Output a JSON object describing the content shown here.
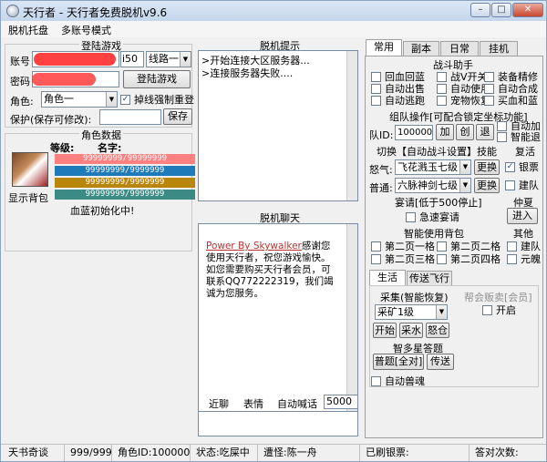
{
  "window": {
    "title": "天行者 - 天行者免费脱机v9.6",
    "controls": {
      "minimize": "–",
      "maximize": "□",
      "close": "✕"
    }
  },
  "menu": [
    "脱机托盘",
    "多账号模式"
  ],
  "login": {
    "title": "登陆游戏",
    "account_label": "账号",
    "account_value": "",
    "server_value": "i50",
    "line_value": "线路一",
    "password_label": "密码",
    "password_value": "",
    "login_button": "登陆游戏",
    "role_label": "角色:",
    "role_value": "角色一",
    "reconnect_label": "掉线强制重登",
    "reconnect_checked": true,
    "protect_label": "保护(保存可修改):",
    "protect_value": "",
    "save_button": "保存"
  },
  "role_data": {
    "title": "角色数据",
    "level_label": "等级:",
    "name_label": "名字:",
    "bars": [
      {
        "text": "99999999/99999999",
        "color": "#ff8080",
        "text_color": "#ffffff"
      },
      {
        "text": "99999999/9999999",
        "color": "#1e7ab8",
        "text_color": "#ffffff"
      },
      {
        "text": "99999999/9999999",
        "color": "#b8860b",
        "text_color": "#ffffff"
      },
      {
        "text": "99999999/9999999",
        "color": "#3c8a84",
        "text_color": "#ffffff"
      }
    ],
    "show_bag": "显示背包",
    "status": "血蓝初始化中!"
  },
  "offline_tips": {
    "title": "脱机提示",
    "lines": [
      ">开始连接大区服务器...",
      ">连接服务器失败...."
    ]
  },
  "offline_chat": {
    "title": "脱机聊天",
    "power_line": "Power By Skywalker",
    "message": "感谢您使用天行者，祝您游戏愉快。如您需要购买天行者会员，可联系QQ772222319，我们竭诚为您服务。",
    "tabs": [
      "近聊",
      "表情",
      "自动喊话"
    ],
    "shout_interval": "5000",
    "input_value": ""
  },
  "right_tabs": [
    "常用",
    "副本",
    "日常",
    "挂机"
  ],
  "battle_helper": {
    "title": "战斗助手",
    "checks": [
      {
        "label": "回血回蓝",
        "checked": false
      },
      {
        "label": "战V开关",
        "checked": false
      },
      {
        "label": "装备精修",
        "checked": false
      },
      {
        "label": "自动出售",
        "checked": false
      },
      {
        "label": "自动使用",
        "checked": false
      },
      {
        "label": "自动合成",
        "checked": false
      },
      {
        "label": "自动逃跑",
        "checked": false
      },
      {
        "label": "宠物恢复",
        "checked": false
      },
      {
        "label": "买血和蓝",
        "checked": false
      }
    ]
  },
  "team": {
    "title": "组队操作[可配合锁定坐标功能]",
    "team_id_label": "队ID:",
    "team_id_value": "1000000",
    "buttons": [
      "加",
      "创",
      "退"
    ],
    "auto_add": "自动加",
    "smart_exit": "智能退"
  },
  "skills": {
    "title": "切换【自动战斗设置】技能",
    "anger_label": "怒气:",
    "anger_value": "飞花溅玉七级",
    "normal_label": "普通:",
    "normal_value": "六脉神剑七级",
    "change_button": "更换"
  },
  "revive": {
    "title": "复活",
    "silver": "银票",
    "silver_checked": true,
    "team": "建队",
    "team_checked": false
  },
  "feast": {
    "title": "宴请[低于500停止]",
    "urgent": "急速宴请"
  },
  "friend": {
    "title": "仲夏",
    "enter_button": "进入"
  },
  "smart_bag": {
    "title": "智能使用背包",
    "checks": [
      "第二页一格",
      "第二页二格",
      "第二页三格",
      "第二页四格"
    ]
  },
  "others": {
    "title": "其他",
    "checks": [
      "建队",
      "元魄"
    ]
  },
  "bottom_tabs": [
    "生活",
    "传送飞行"
  ],
  "gather": {
    "title": "采集(智能恢复)",
    "select_value": "采矿1级",
    "buttons": [
      "开始",
      "采水",
      "怒仓"
    ]
  },
  "guild_sale": {
    "title": "帮会贩卖[会员]",
    "open_label": "开启"
  },
  "star_quiz": {
    "title": "智多星答题",
    "quiz_button": "普题[全对]",
    "teleport_button": "传送"
  },
  "auto_beast": "自动兽魂",
  "statusbar": [
    "天书奇谈",
    "999/999",
    "角色ID:1000000",
    "状态:吃屎中",
    "遭怪:陈一舟",
    "已刷银票:",
    "答对次数:"
  ]
}
